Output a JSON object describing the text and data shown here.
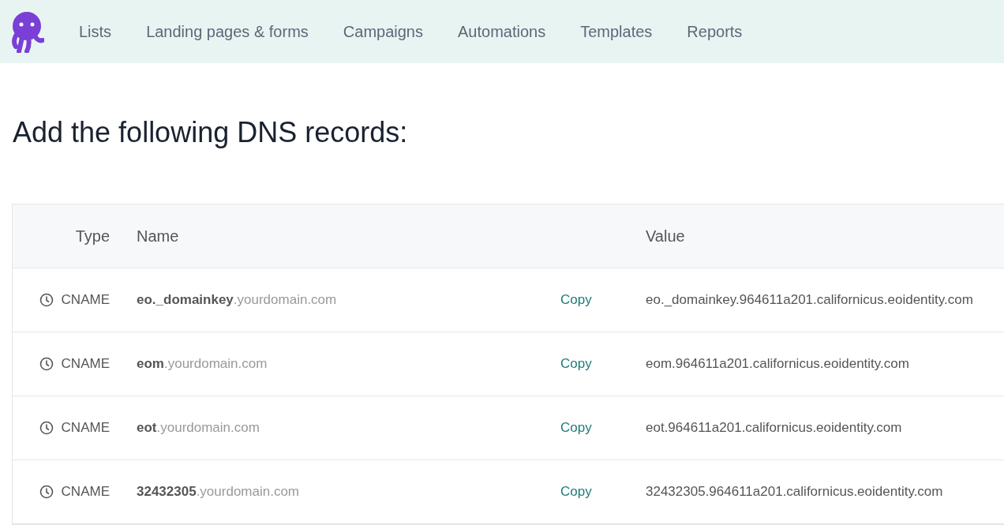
{
  "nav": {
    "items": [
      {
        "label": "Lists"
      },
      {
        "label": "Landing pages & forms"
      },
      {
        "label": "Campaigns"
      },
      {
        "label": "Automations"
      },
      {
        "label": "Templates"
      },
      {
        "label": "Reports"
      }
    ]
  },
  "heading": "Add the following DNS records:",
  "table": {
    "columns": [
      "Type",
      "Name",
      "Value"
    ],
    "rows": [
      {
        "type": "CNAME",
        "name": "**eo._domainkey**.yourdomain.com",
        "action": "Copy",
        "value": "eo._domainkey.964611a201.californicus.eoidentity.com"
      },
      {
        "type": "CNAME",
        "name": "**eom**.yourdomain.com",
        "action": "Copy",
        "value": "eom.964611a201.californicus.eoidentity.com"
      },
      {
        "type": "CNAME",
        "name": "**eot**.yourdomain.com",
        "action": "Copy",
        "value": "eot.964611a201.californicus.eoidentity.com"
      },
      {
        "type": "CNAME",
        "name": "**32432305**.yourdomain.com",
        "action": "Copy",
        "value": "32432305.964611a201.californicus.eoidentity.com"
      }
    ]
  }
}
